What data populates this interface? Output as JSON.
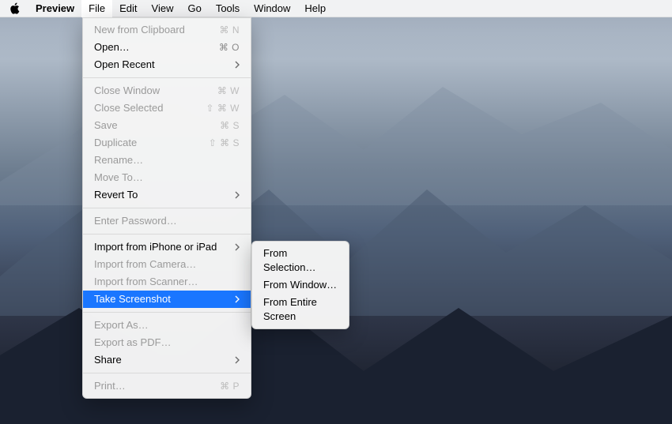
{
  "menubar": {
    "app": "Preview",
    "items": [
      "File",
      "Edit",
      "View",
      "Go",
      "Tools",
      "Window",
      "Help"
    ],
    "open_index": 0
  },
  "file_menu": {
    "groups": [
      [
        {
          "label": "New from Clipboard",
          "shortcut": "⌘ N",
          "enabled": false
        },
        {
          "label": "Open…",
          "shortcut": "⌘ O",
          "enabled": true
        },
        {
          "label": "Open Recent",
          "submenu": true,
          "enabled": true
        }
      ],
      [
        {
          "label": "Close Window",
          "shortcut": "⌘ W",
          "enabled": false
        },
        {
          "label": "Close Selected",
          "shortcut": "⇧ ⌘ W",
          "enabled": false
        },
        {
          "label": "Save",
          "shortcut": "⌘ S",
          "enabled": false
        },
        {
          "label": "Duplicate",
          "shortcut": "⇧ ⌘ S",
          "enabled": false
        },
        {
          "label": "Rename…",
          "enabled": false
        },
        {
          "label": "Move To…",
          "enabled": false
        },
        {
          "label": "Revert To",
          "submenu": true,
          "enabled": true
        }
      ],
      [
        {
          "label": "Enter Password…",
          "enabled": false
        }
      ],
      [
        {
          "label": "Import from iPhone or iPad",
          "submenu": true,
          "enabled": true
        },
        {
          "label": "Import from Camera…",
          "enabled": false
        },
        {
          "label": "Import from Scanner…",
          "enabled": false
        },
        {
          "label": "Take Screenshot",
          "submenu": true,
          "enabled": true,
          "selected": true
        }
      ],
      [
        {
          "label": "Export As…",
          "enabled": false
        },
        {
          "label": "Export as PDF…",
          "enabled": false
        },
        {
          "label": "Share",
          "submenu": true,
          "enabled": true
        }
      ],
      [
        {
          "label": "Print…",
          "shortcut": "⌘ P",
          "enabled": false
        }
      ]
    ]
  },
  "screenshot_submenu": {
    "items": [
      "From Selection…",
      "From Window…",
      "From Entire Screen"
    ]
  }
}
